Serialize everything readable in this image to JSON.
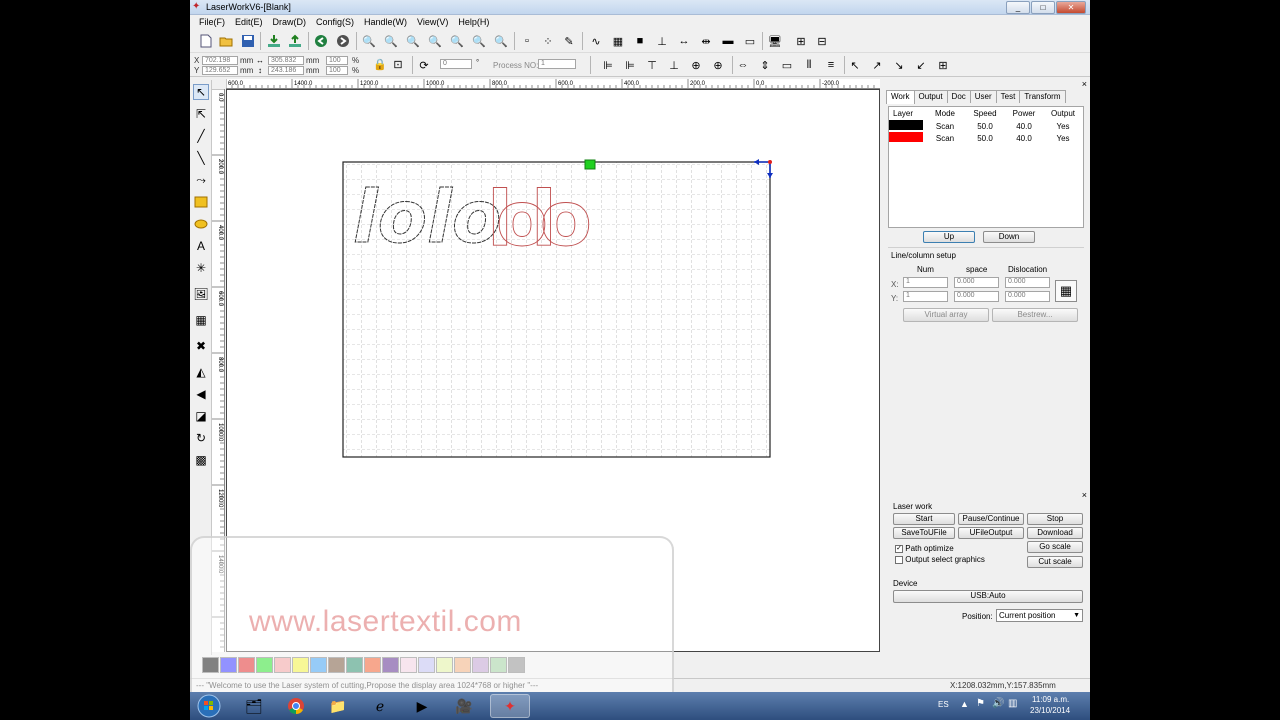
{
  "window": {
    "title": "LaserWorkV6-[Blank]",
    "min": "_",
    "max": "□",
    "close": "✕"
  },
  "menu": [
    "File(F)",
    "Edit(E)",
    "Draw(D)",
    "Config(S)",
    "Handle(W)",
    "View(V)",
    "Help(H)"
  ],
  "coords": {
    "x_label": "X",
    "y_label": "Y",
    "x_value": "702.198",
    "y_value": "129.652",
    "w_value": "305.832",
    "h_value": "243.186",
    "unit": "mm",
    "sx_value": "100",
    "sy_value": "100",
    "pct": "%",
    "angle_value": "0",
    "deg": "°",
    "process_label": "Process NO:",
    "process_value": "1"
  },
  "ruler_h": [
    "600.0",
    "1400.0",
    "1200.0",
    "1000.0",
    "800.0",
    "600.0",
    "400.0",
    "200.0",
    "0.0",
    "-200.0"
  ],
  "ruler_v": [
    "0.0",
    "200.0",
    "400.0",
    "600.0",
    "800.0",
    "1000.0",
    "1200.0",
    "1400.0"
  ],
  "canvas": {
    "text_black": "lolo",
    "text_red": "lolo"
  },
  "panel": {
    "tabs": [
      "Work",
      "Output",
      "Doc",
      "User",
      "Test",
      "Transform"
    ],
    "layer_headers": [
      "Layer",
      "Mode",
      "Speed",
      "Power",
      "Output"
    ],
    "layers": [
      {
        "color": "#000000",
        "mode": "Scan",
        "speed": "50.0",
        "power": "40.0",
        "output": "Yes"
      },
      {
        "color": "#ff0000",
        "mode": "Scan",
        "speed": "50.0",
        "power": "40.0",
        "output": "Yes"
      }
    ],
    "up": "Up",
    "down": "Down",
    "line_col_title": "Line/column setup",
    "num": "Num",
    "space": "space",
    "dislocation": "Dislocation",
    "x_label": "X:",
    "y_label": "Y:",
    "x_num": "1",
    "x_space": "0.000",
    "x_disloc": "0.000",
    "y_num": "1",
    "y_space": "0.000",
    "y_disloc": "0.000",
    "virtual_array": "Virtual array",
    "bestrew": "Bestrew..."
  },
  "laser": {
    "title": "Laser work",
    "start": "Start",
    "pause": "Pause/Continue",
    "stop": "Stop",
    "save_u": "SaveToUFile",
    "u_output": "UFileOutput",
    "download": "Download",
    "path_opt": "Path optimize",
    "output_sel": "Output select graphics",
    "go_scale": "Go scale",
    "cut_scale": "Cut scale",
    "device": "Device",
    "usb": "USB:Auto",
    "position_label": "Position:",
    "position_value": "Current position"
  },
  "palette": [
    "#1a1a1a",
    "#3a3aff",
    "#e03030",
    "#30e030",
    "#f0a0a0",
    "#f0f040",
    "#40a0f0",
    "#7a5a40",
    "#309070",
    "#f06030",
    "#603090",
    "#f0d0e0",
    "#c0c0f0",
    "#e0f0a0",
    "#f0b080",
    "#c0a0d0",
    "#a0d0a0",
    "#909090"
  ],
  "status": {
    "message": "--- \"Welcome to use the Laser system of cutting,Propose the display area 1024*768 or higher \"---",
    "coord": "X:1208.032mm,Y:157.835mm"
  },
  "watermark": "www.lasertextil.com",
  "taskbar": {
    "lang": "ES",
    "time": "11:09 a.m.",
    "date": "23/10/2014"
  }
}
